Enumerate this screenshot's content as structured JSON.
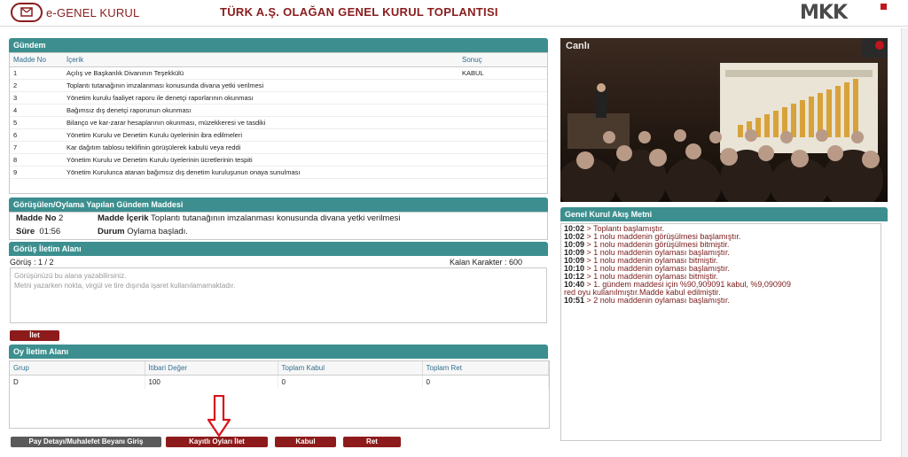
{
  "header": {
    "logo_text": "e-GENEL KURUL",
    "title": "TÜRK A.Ş. OLAĞAN GENEL KURUL TOPLANTISI",
    "brand": "MKK"
  },
  "agenda": {
    "title": "Gündem",
    "columns": [
      "Madde No",
      "İçerik",
      "Sonuç"
    ],
    "rows": [
      {
        "no": "1",
        "content": "Açılış ve Başkanlık Divanının Teşekkülü",
        "result": "KABUL"
      },
      {
        "no": "2",
        "content": "Toplantı tutanağının imzalanması konusunda divana yetki verilmesi",
        "result": ""
      },
      {
        "no": "3",
        "content": "Yönetim kurulu faaliyet raporu ile denetçi raporlarının okunması",
        "result": ""
      },
      {
        "no": "4",
        "content": "Bağımsız dış denetçi raporunun okunması",
        "result": ""
      },
      {
        "no": "5",
        "content": "Bilanço ve kar-zarar hesaplarının okunması, müzekkeresi ve tasdiki",
        "result": ""
      },
      {
        "no": "6",
        "content": "Yönetim Kurulu ve Denetim Kurulu üyelerinin ibra edilmeleri",
        "result": ""
      },
      {
        "no": "7",
        "content": "Kar dağıtım tablosu teklifinin görüşülerek kabulü veya reddi",
        "result": ""
      },
      {
        "no": "8",
        "content": "Yönetim Kurulu ve Denetim Kurulu üyelerinin ücretlerinin tespiti",
        "result": ""
      },
      {
        "no": "9",
        "content": "Yönetim Kurulunca atanan bağımsız dış denetim kuruluşunun onaya sunulması",
        "result": ""
      }
    ]
  },
  "current_item": {
    "title": "Görüşülen/Oylama Yapılan Gündem Maddesi",
    "no_label": "Madde No",
    "no_value": "2",
    "content_label": "Madde İçerik",
    "content_value": "Toplantı tutanağının imzalanması konusunda divana yetki verilmesi",
    "duration_label": "Süre",
    "duration_value": "01:56",
    "status_label": "Durum",
    "status_value": "Oylama başladı."
  },
  "opinion": {
    "title": "Görüş İletim Alanı",
    "count_text": "Görüş : 1 / 2",
    "remaining_text": "Kalan Karakter : 600",
    "placeholder_line1": "Görüşünüzü bu alana yazabilirsiniz.",
    "placeholder_line2": "Metni yazarken nokta, virgül ve tire dışında işaret kullanılamamaktadır.",
    "send_label": "İlet"
  },
  "vote": {
    "title": "Oy İletim Alanı",
    "columns": [
      "Grup",
      "İtibari Değer",
      "Toplam Kabul",
      "Toplam Ret"
    ],
    "rows": [
      {
        "group": "D",
        "nominal": "100",
        "accept": "0",
        "reject": "0"
      }
    ]
  },
  "buttons": {
    "pay_detail": "Pay Detayı/Muhalefet Beyanı Giriş",
    "send_registered": "Kayıtlı Oyları İlet",
    "accept": "Kabul",
    "reject": "Ret"
  },
  "video": {
    "label": "Canlı"
  },
  "flow": {
    "title": "Genel Kurul Akış Metni",
    "lines": [
      {
        "time": "10:02",
        "text": " > Toplantı başlamıştır."
      },
      {
        "time": "10:02",
        "text": " > 1 nolu maddenin görüşülmesi başlamıştır."
      },
      {
        "time": "10:09",
        "text": " > 1 nolu maddenin görüşülmesi bitmiştir."
      },
      {
        "time": "10:09",
        "text": " > 1 nolu maddenin oylaması başlamıştır."
      },
      {
        "time": "10:09",
        "text": " > 1 nolu maddenin oylaması bitmiştir."
      },
      {
        "time": "10:10",
        "text": " > 1 nolu maddenin oylaması başlamıştır."
      },
      {
        "time": "10:12",
        "text": " > 1 nolu maddenin oylaması bitmiştir."
      },
      {
        "time": "10:40",
        "text": " > 1. gündem maddesi için %90,909091 kabul, %9,090909"
      },
      {
        "time": "",
        "text": "red oyu kullanılmıştır.Madde kabul edilmiştir."
      },
      {
        "time": "10:51",
        "text": " > 2 nolu maddenin oylaması başlamıştır."
      }
    ]
  },
  "colors": {
    "accent": "#3d8f8f",
    "brand": "#8a1d1d",
    "button_red": "#8e1b1b"
  }
}
